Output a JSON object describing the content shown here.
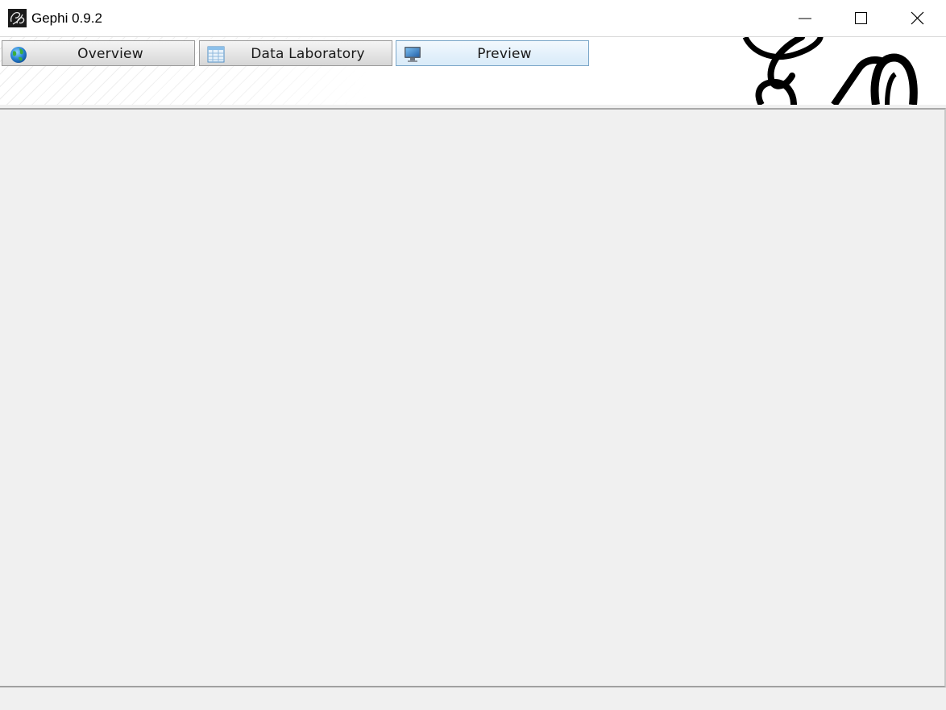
{
  "window": {
    "title": "Gephi 0.9.2",
    "controls": {
      "minimize_icon": "minimize-icon",
      "maximize_icon": "maximize-icon",
      "close_icon": "close-icon"
    }
  },
  "toolbar": {
    "tabs": [
      {
        "label": "Overview",
        "icon": "globe-icon",
        "active": false
      },
      {
        "label": "Data Laboratory",
        "icon": "table-icon",
        "active": false
      },
      {
        "label": "Preview",
        "icon": "monitor-icon",
        "active": true
      }
    ]
  },
  "colors": {
    "active_tab_border": "#7aa6c8",
    "workspace_bg": "#f0f0f0",
    "titlebar_bg": "#ffffff"
  }
}
